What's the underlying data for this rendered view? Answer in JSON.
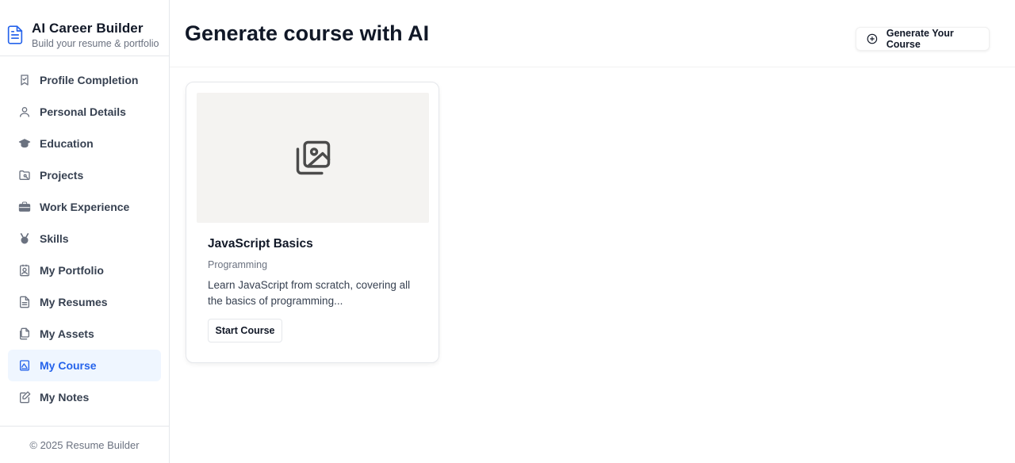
{
  "brand": {
    "title": "AI Career Builder",
    "subtitle": "Build your resume & portfolio",
    "icon": "file-text-icon"
  },
  "sidebar": {
    "items": [
      {
        "label": "Profile Completion",
        "icon": "bookmark-icon",
        "active": false
      },
      {
        "label": "Personal Details",
        "icon": "user-icon",
        "active": false
      },
      {
        "label": "Education",
        "icon": "graduation-cap-icon",
        "active": false
      },
      {
        "label": "Projects",
        "icon": "folder-git-icon",
        "active": false
      },
      {
        "label": "Work Experience",
        "icon": "briefcase-icon",
        "active": false
      },
      {
        "label": "Skills",
        "icon": "medal-icon",
        "active": false
      },
      {
        "label": "My Portfolio",
        "icon": "contact-icon",
        "active": false
      },
      {
        "label": "My Resumes",
        "icon": "file-text-icon",
        "active": false
      },
      {
        "label": "My Assets",
        "icon": "files-icon",
        "active": false
      },
      {
        "label": "My Course",
        "icon": "book-image-icon",
        "active": true
      },
      {
        "label": "My Notes",
        "icon": "notebook-pen-icon",
        "active": false
      }
    ],
    "footer": "© 2025 Resume Builder"
  },
  "header": {
    "title": "Generate course with AI",
    "generate_button": "Generate Your Course",
    "generate_icon": "plus-circle-icon"
  },
  "courses": [
    {
      "title": "JavaScript Basics",
      "category": "Programming",
      "description": "Learn JavaScript from scratch, covering all the basics of programming...",
      "button": "Start Course",
      "thumbnail_icon": "images-icon"
    }
  ],
  "colors": {
    "accent": "#2563eb",
    "active_bg": "#eff6ff",
    "thumb_bg": "#f4f3f1"
  }
}
